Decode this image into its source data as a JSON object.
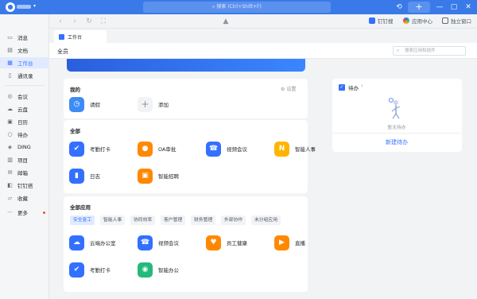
{
  "titlebar": {
    "search_placeholder": "搜索 (Ctrl+Shift+F)",
    "add_label": "+",
    "icons": [
      "history-icon",
      "minimize-icon",
      "maximize-icon",
      "close-icon"
    ]
  },
  "toolbar": {
    "dingdan": "钉钉搜",
    "app_center": "应用中心",
    "standalone": "独立窗口"
  },
  "sidebar": {
    "items": [
      {
        "label": "消息",
        "icon": "message-icon"
      },
      {
        "label": "文档",
        "icon": "doc-icon"
      },
      {
        "label": "工作台",
        "icon": "workbench-icon"
      },
      {
        "label": "通讯录",
        "icon": "contacts-icon"
      },
      {
        "label": "会议",
        "icon": "meeting-icon"
      },
      {
        "label": "云盘",
        "icon": "cloud-icon"
      },
      {
        "label": "日历",
        "icon": "calendar-icon"
      },
      {
        "label": "待办",
        "icon": "todo-icon"
      },
      {
        "label": "DING",
        "icon": "ding-icon"
      },
      {
        "label": "项目",
        "icon": "project-icon"
      },
      {
        "label": "邮箱",
        "icon": "mail-icon"
      },
      {
        "label": "钉钉搭",
        "icon": "build-icon"
      },
      {
        "label": "收藏",
        "icon": "favorite-icon"
      },
      {
        "label": "更多",
        "icon": "more-icon"
      }
    ],
    "active_color": "#3370ff"
  },
  "tab": {
    "label": "工作台"
  },
  "header": {
    "title": "全员",
    "search_placeholder": "搜索应用和插件"
  },
  "mine": {
    "title": "我的",
    "settings": "设置",
    "apps": [
      {
        "label": "请假",
        "color": "#3d8cf5",
        "icon": "leave-icon",
        "glyph": "◷"
      },
      {
        "label": "添加",
        "icon": "plus-icon",
        "glyph": "+"
      }
    ]
  },
  "all": {
    "title": "全部",
    "apps": [
      {
        "label": "考勤打卡",
        "color": "#3370ff",
        "icon": "attendance-icon",
        "glyph": "✔"
      },
      {
        "label": "OA审批",
        "color": "#ff8800",
        "icon": "approval-icon",
        "glyph": "👤"
      },
      {
        "label": "视频会议",
        "color": "#3370ff",
        "icon": "video-meeting-icon",
        "glyph": "☎"
      },
      {
        "label": "智能人事",
        "color": "#ffb400",
        "icon": "hr-icon",
        "glyph": "N"
      },
      {
        "label": "日志",
        "color": "#3370ff",
        "icon": "log-icon",
        "glyph": "▮"
      },
      {
        "label": "智能招聘",
        "color": "#ff8800",
        "icon": "recruit-icon",
        "glyph": "▣"
      }
    ]
  },
  "all_apps": {
    "title": "全部应用",
    "chips": [
      "安全复工",
      "智能人事",
      "协同效率",
      "客户管理",
      "财务管理",
      "外部协作",
      "未分组应用"
    ],
    "apps": [
      {
        "label": "云端办公室",
        "color": "#3370ff",
        "icon": "cloud-office-icon",
        "glyph": "☁"
      },
      {
        "label": "视频会议",
        "color": "#3370ff",
        "icon": "video-meeting-icon",
        "glyph": "☎"
      },
      {
        "label": "员工健康",
        "color": "#ff8800",
        "icon": "health-icon",
        "glyph": "♥"
      },
      {
        "label": "直播",
        "color": "#ff8800",
        "icon": "live-icon",
        "glyph": "▶"
      },
      {
        "label": "考勤打卡",
        "color": "#3370ff",
        "icon": "attendance-icon",
        "glyph": "✔"
      },
      {
        "label": "智能办公",
        "color": "#25b97b",
        "icon": "smart-office-icon",
        "glyph": "◉"
      }
    ]
  },
  "todo": {
    "title": "待办",
    "empty": "暂无待办",
    "new": "新建待办"
  }
}
